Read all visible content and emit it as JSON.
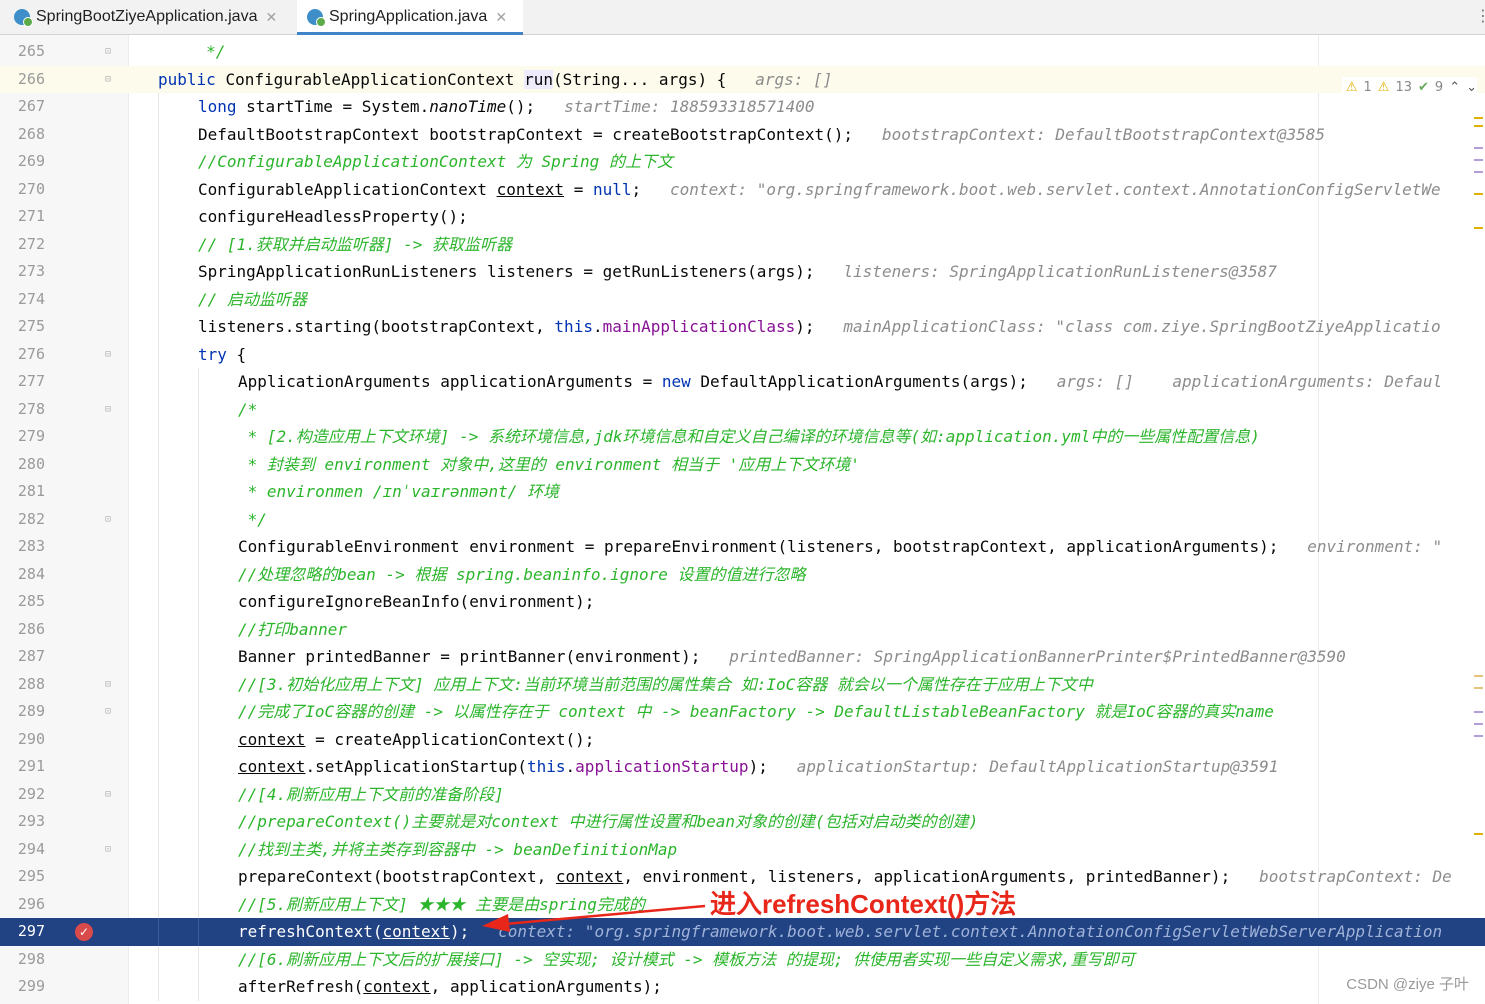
{
  "tabs": [
    {
      "label": "SpringBootZiyeApplication.java",
      "active": false
    },
    {
      "label": "SpringApplication.java",
      "active": true
    }
  ],
  "inspections": {
    "warnings": "1",
    "weak_warnings": "13",
    "typos": "9"
  },
  "lines": [
    {
      "n": "265",
      "fold": "end",
      "ind": 0,
      "segs": [
        {
          "c": "cm",
          "t": "     */"
        }
      ]
    },
    {
      "n": "266",
      "fold": "start",
      "current": true,
      "ind": 0,
      "segs": [
        {
          "c": "kw",
          "t": "public "
        },
        {
          "c": "plain",
          "t": "ConfigurableApplicationContext "
        },
        {
          "c": "plain mhl",
          "t": "run"
        },
        {
          "c": "plain",
          "t": "(String... args) {   "
        },
        {
          "c": "hint",
          "t": "args: []"
        }
      ]
    },
    {
      "n": "267",
      "ind": 1,
      "segs": [
        {
          "c": "kw",
          "t": "long "
        },
        {
          "c": "plain",
          "t": "startTime = System."
        },
        {
          "c": "plain it",
          "t": "nanoTime"
        },
        {
          "c": "plain",
          "t": "();   "
        },
        {
          "c": "hint",
          "t": "startTime: 188593318571400"
        }
      ]
    },
    {
      "n": "268",
      "ind": 1,
      "segs": [
        {
          "c": "plain",
          "t": "DefaultBootstrapContext bootstrapContext = createBootstrapContext();   "
        },
        {
          "c": "hint",
          "t": "bootstrapContext: DefaultBootstrapContext@3585"
        }
      ]
    },
    {
      "n": "269",
      "ind": 1,
      "segs": [
        {
          "c": "cm",
          "t": "//ConfigurableApplicationContext 为 Spring 的上下文"
        }
      ]
    },
    {
      "n": "270",
      "ind": 1,
      "segs": [
        {
          "c": "plain",
          "t": "ConfigurableApplicationContext "
        },
        {
          "c": "plain ul",
          "t": "context"
        },
        {
          "c": "plain",
          "t": " = "
        },
        {
          "c": "kw",
          "t": "null"
        },
        {
          "c": "plain",
          "t": ";   "
        },
        {
          "c": "hint",
          "t": "context: \"org.springframework.boot.web.servlet.context.AnnotationConfigServletWe"
        }
      ]
    },
    {
      "n": "271",
      "ind": 1,
      "segs": [
        {
          "c": "plain",
          "t": "configureHeadlessProperty();"
        }
      ]
    },
    {
      "n": "272",
      "ind": 1,
      "segs": [
        {
          "c": "cm",
          "t": "// [1.获取并启动监听器] -> 获取监听器"
        }
      ]
    },
    {
      "n": "273",
      "ind": 1,
      "segs": [
        {
          "c": "plain",
          "t": "SpringApplicationRunListeners listeners = getRunListeners(args);   "
        },
        {
          "c": "hint",
          "t": "listeners: SpringApplicationRunListeners@3587"
        }
      ]
    },
    {
      "n": "274",
      "ind": 1,
      "segs": [
        {
          "c": "cm",
          "t": "// 启动监听器"
        }
      ]
    },
    {
      "n": "275",
      "ind": 1,
      "segs": [
        {
          "c": "plain",
          "t": "listeners.starting(bootstrapContext, "
        },
        {
          "c": "kw",
          "t": "this"
        },
        {
          "c": "plain",
          "t": "."
        },
        {
          "c": "fld",
          "t": "mainApplicationClass"
        },
        {
          "c": "plain",
          "t": ");   "
        },
        {
          "c": "hint",
          "t": "mainApplicationClass: \"class com.ziye.SpringBootZiyeApplicatio"
        }
      ]
    },
    {
      "n": "276",
      "fold": "start",
      "ind": 1,
      "segs": [
        {
          "c": "kw",
          "t": "try "
        },
        {
          "c": "plain",
          "t": "{"
        }
      ]
    },
    {
      "n": "277",
      "ind": 2,
      "segs": [
        {
          "c": "plain",
          "t": "ApplicationArguments applicationArguments = "
        },
        {
          "c": "kw",
          "t": "new "
        },
        {
          "c": "plain",
          "t": "DefaultApplicationArguments(args);   "
        },
        {
          "c": "hint",
          "t": "args: []    applicationArguments: Defaul"
        }
      ]
    },
    {
      "n": "278",
      "fold": "start",
      "ind": 2,
      "segs": [
        {
          "c": "cmdoc",
          "t": "/*"
        }
      ]
    },
    {
      "n": "279",
      "ind": 2,
      "segs": [
        {
          "c": "cmdoc",
          "t": " * [2.构造应用上下文环境] -> 系统环境信息,jdk环境信息和自定义自己编译的环境信息等(如:application.yml中的一些属性配置信息)"
        }
      ]
    },
    {
      "n": "280",
      "ind": 2,
      "segs": [
        {
          "c": "cmdoc",
          "t": " * 封装到 environment 对象中,这里的 environment 相当于 '应用上下文环境'"
        }
      ]
    },
    {
      "n": "281",
      "ind": 2,
      "segs": [
        {
          "c": "cmdoc",
          "t": " * environmen /ɪnˈvaɪrənmənt/ 环境"
        }
      ]
    },
    {
      "n": "282",
      "fold": "end",
      "ind": 2,
      "segs": [
        {
          "c": "cmdoc",
          "t": " */"
        }
      ]
    },
    {
      "n": "283",
      "ind": 2,
      "segs": [
        {
          "c": "plain",
          "t": "ConfigurableEnvironment environment = prepareEnvironment(listeners, bootstrapContext, applicationArguments);   "
        },
        {
          "c": "hint",
          "t": "environment: \""
        }
      ]
    },
    {
      "n": "284",
      "ind": 2,
      "segs": [
        {
          "c": "cm",
          "t": "//处理忽略的bean -> 根据 spring.beaninfo.ignore 设置的值进行忽略"
        }
      ]
    },
    {
      "n": "285",
      "ind": 2,
      "segs": [
        {
          "c": "plain",
          "t": "configureIgnoreBeanInfo(environment);"
        }
      ]
    },
    {
      "n": "286",
      "ind": 2,
      "segs": [
        {
          "c": "cm",
          "t": "//打印banner"
        }
      ]
    },
    {
      "n": "287",
      "ind": 2,
      "segs": [
        {
          "c": "plain",
          "t": "Banner printedBanner = printBanner(environment);   "
        },
        {
          "c": "hint",
          "t": "printedBanner: SpringApplicationBannerPrinter$PrintedBanner@3590"
        }
      ]
    },
    {
      "n": "288",
      "fold": "start",
      "ind": 2,
      "segs": [
        {
          "c": "cm",
          "t": "//[3.初始化应用上下文] 应用上下文:当前环境当前范围的属性集合 如:IoC容器 就会以一个属性存在于应用上下文中"
        }
      ]
    },
    {
      "n": "289",
      "fold": "end",
      "ind": 2,
      "segs": [
        {
          "c": "cm",
          "t": "//完成了IoC容器的创建 -> 以属性存在于 context 中 -> beanFactory -> DefaultListableBeanFactory 就是IoC容器的真实name"
        }
      ]
    },
    {
      "n": "290",
      "ind": 2,
      "segs": [
        {
          "c": "plain ul",
          "t": "context"
        },
        {
          "c": "plain",
          "t": " = createApplicationContext();"
        }
      ]
    },
    {
      "n": "291",
      "ind": 2,
      "segs": [
        {
          "c": "plain ul",
          "t": "context"
        },
        {
          "c": "plain",
          "t": ".setApplicationStartup("
        },
        {
          "c": "kw",
          "t": "this"
        },
        {
          "c": "plain",
          "t": "."
        },
        {
          "c": "fld",
          "t": "applicationStartup"
        },
        {
          "c": "plain",
          "t": ");   "
        },
        {
          "c": "hint",
          "t": "applicationStartup: DefaultApplicationStartup@3591"
        }
      ]
    },
    {
      "n": "292",
      "fold": "start",
      "ind": 2,
      "segs": [
        {
          "c": "cm",
          "t": "//[4.刷新应用上下文前的准备阶段]"
        }
      ]
    },
    {
      "n": "293",
      "ind": 2,
      "segs": [
        {
          "c": "cm",
          "t": "//prepareContext()主要就是对context 中进行属性设置和bean对象的创建(包括对启动类的创建)"
        }
      ]
    },
    {
      "n": "294",
      "fold": "end",
      "ind": 2,
      "segs": [
        {
          "c": "cm",
          "t": "//找到主类,并将主类存到容器中 -> beanDefinitionMap"
        }
      ]
    },
    {
      "n": "295",
      "ind": 2,
      "segs": [
        {
          "c": "plain",
          "t": "prepareContext(bootstrapContext, "
        },
        {
          "c": "plain ul",
          "t": "context"
        },
        {
          "c": "plain",
          "t": ", environment, listeners, applicationArguments, printedBanner);   "
        },
        {
          "c": "hint",
          "t": "bootstrapContext: De"
        }
      ]
    },
    {
      "n": "296",
      "ind": 2,
      "segs": [
        {
          "c": "cm",
          "t": "//[5.刷新应用上下文] ★★★ 主要是由spring完成的"
        }
      ]
    },
    {
      "n": "297",
      "selected": true,
      "bp": true,
      "ind": 2,
      "segs": [
        {
          "c": "plain",
          "t": "refreshContext("
        },
        {
          "c": "plain ul",
          "t": "context"
        },
        {
          "c": "plain",
          "t": ");   "
        },
        {
          "c": "hint",
          "t": "context: \"org.springframework.boot.web.servlet.context.AnnotationConfigServletWebServerApplication"
        }
      ]
    },
    {
      "n": "298",
      "ind": 2,
      "segs": [
        {
          "c": "cm",
          "t": "//[6.刷新应用上下文后的扩展接口] -> 空实现; 设计模式 -> 模板方法 的提现; 供使用者实现一些自定义需求,重写即可"
        }
      ]
    },
    {
      "n": "299",
      "ind": 2,
      "segs": [
        {
          "c": "plain",
          "t": "afterRefresh("
        },
        {
          "c": "plain ul",
          "t": "context"
        },
        {
          "c": "plain",
          "t": ", applicationArguments);"
        }
      ]
    }
  ],
  "annotation": "进入refreshContext()方法",
  "watermark": "CSDN @ziye 子叶",
  "colors": {
    "keyword": "#0033b3",
    "comment": "#2bb52b",
    "hint": "#8c8c8c",
    "selection": "#214283",
    "annotation": "#e8261a"
  }
}
